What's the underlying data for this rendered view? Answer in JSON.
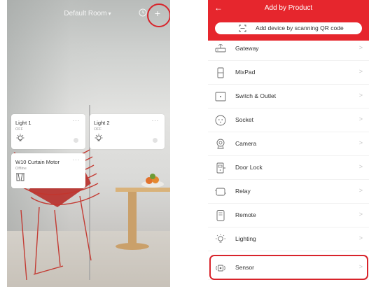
{
  "left_screen": {
    "room_title": "Default Room",
    "room_caret": "▾",
    "add_glyph": "+",
    "icons": [
      "timer-icon",
      "add-icon"
    ],
    "highlight_color": "#d8242b",
    "cards": [
      {
        "title": "Light 1",
        "status": "OFF",
        "more": "···",
        "icon": "bulb-icon"
      },
      {
        "title": "Light 2",
        "status": "OFF",
        "more": "···",
        "icon": "bulb-icon"
      },
      {
        "title": "W10 Curtain Motor",
        "status": "Offline",
        "more": "···",
        "icon": "curtain-icon"
      }
    ]
  },
  "right_screen": {
    "header": {
      "title": "Add by Product",
      "back_glyph": "←",
      "color": "#e6262d"
    },
    "scan_label": "Add device by scanning QR code",
    "chevron_glyph": ">",
    "items": [
      {
        "label": "Gateway",
        "icon": "gateway-icon"
      },
      {
        "label": "MixPad",
        "icon": "mixpad-icon"
      },
      {
        "label": "Switch & Outlet",
        "icon": "switch-outlet-icon"
      },
      {
        "label": "Socket",
        "icon": "socket-icon"
      },
      {
        "label": "Camera",
        "icon": "camera-icon"
      },
      {
        "label": "Door Lock",
        "icon": "door-lock-icon"
      },
      {
        "label": "Relay",
        "icon": "relay-icon"
      },
      {
        "label": "Remote",
        "icon": "remote-icon"
      },
      {
        "label": "Lighting",
        "icon": "lighting-icon"
      },
      {
        "label": "Sensor",
        "icon": "sensor-icon"
      }
    ]
  }
}
